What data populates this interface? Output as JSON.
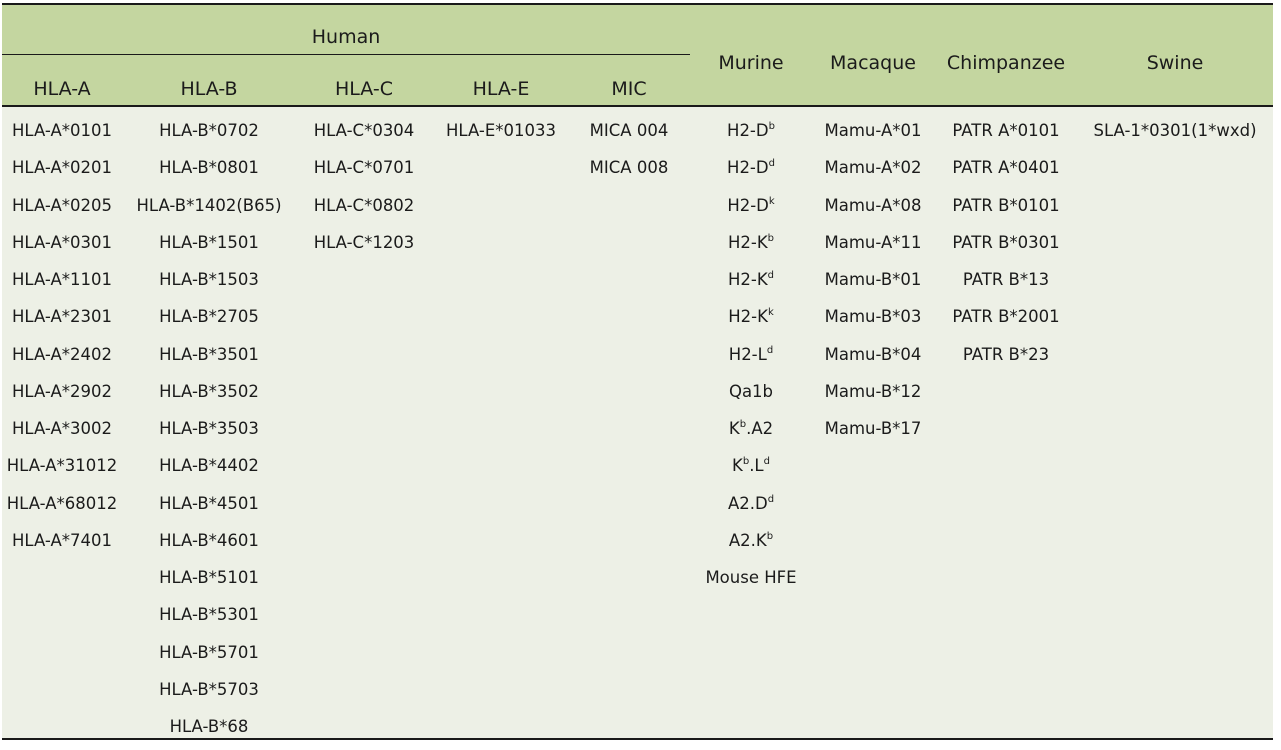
{
  "header": {
    "group_label": "Human",
    "columns": [
      {
        "key": "hla_a",
        "label": "HLA-A"
      },
      {
        "key": "hla_b",
        "label": "HLA-B"
      },
      {
        "key": "hla_c",
        "label": "HLA-C"
      },
      {
        "key": "hla_e",
        "label": "HLA-E"
      },
      {
        "key": "mic",
        "label": "MIC"
      },
      {
        "key": "murine",
        "label": "Murine"
      },
      {
        "key": "macaque",
        "label": "Macaque"
      },
      {
        "key": "chimpanzee",
        "label": "Chimpanzee"
      },
      {
        "key": "swine",
        "label": "Swine"
      }
    ]
  },
  "columns": {
    "hla_a": [
      "HLA-A*0101",
      "HLA-A*0201",
      "HLA-A*0205",
      "HLA-A*0301",
      "HLA-A*1101",
      "HLA-A*2301",
      "HLA-A*2402",
      "HLA-A*2902",
      "HLA-A*3002",
      "HLA-A*31012",
      "HLA-A*68012",
      "HLA-A*7401"
    ],
    "hla_b": [
      "HLA-B*0702",
      "HLA-B*0801",
      "HLA-B*1402(B65)",
      "HLA-B*1501",
      "HLA-B*1503",
      "HLA-B*2705",
      "HLA-B*3501",
      "HLA-B*3502",
      "HLA-B*3503",
      "HLA-B*4402",
      "HLA-B*4501",
      "HLA-B*4601",
      "HLA-B*5101",
      "HLA-B*5301",
      "HLA-B*5701",
      "HLA-B*5703",
      "HLA-B*68"
    ],
    "hla_c": [
      "HLA-C*0304",
      "HLA-C*0701",
      "HLA-C*0802",
      "HLA-C*1203"
    ],
    "hla_e": [
      "HLA-E*01033"
    ],
    "mic": [
      "MICA 004",
      "MICA 008"
    ],
    "murine": [
      {
        "base": "H2-D",
        "sup": "b"
      },
      {
        "base": "H2-D",
        "sup": "d"
      },
      {
        "base": "H2-D",
        "sup": "k"
      },
      {
        "base": "H2-K",
        "sup": "b"
      },
      {
        "base": "H2-K",
        "sup": "d"
      },
      {
        "base": "H2-K",
        "sup": "k"
      },
      {
        "base": "H2-L",
        "sup": "d"
      },
      {
        "base": "Qa1b"
      },
      {
        "base": "K",
        "sup": "b",
        "rest": ".A2"
      },
      {
        "base": "K",
        "sup": "b",
        "rest": ".L",
        "sup2": "d"
      },
      {
        "base": "A2.D",
        "sup": "d"
      },
      {
        "base": "A2.K",
        "sup": "b"
      },
      {
        "base": "Mouse HFE"
      }
    ],
    "macaque": [
      "Mamu-A*01",
      "Mamu-A*02",
      "Mamu-A*08",
      "Mamu-A*11",
      "Mamu-B*01",
      "Mamu-B*03",
      "Mamu-B*04",
      "Mamu-B*12",
      "Mamu-B*17"
    ],
    "chimpanzee": [
      "PATR A*0101",
      "PATR A*0401",
      "PATR B*0101",
      "PATR B*0301",
      "PATR B*13",
      "PATR B*2001",
      "PATR B*23"
    ],
    "swine": [
      "SLA-1*0301(1*wxd)"
    ]
  }
}
